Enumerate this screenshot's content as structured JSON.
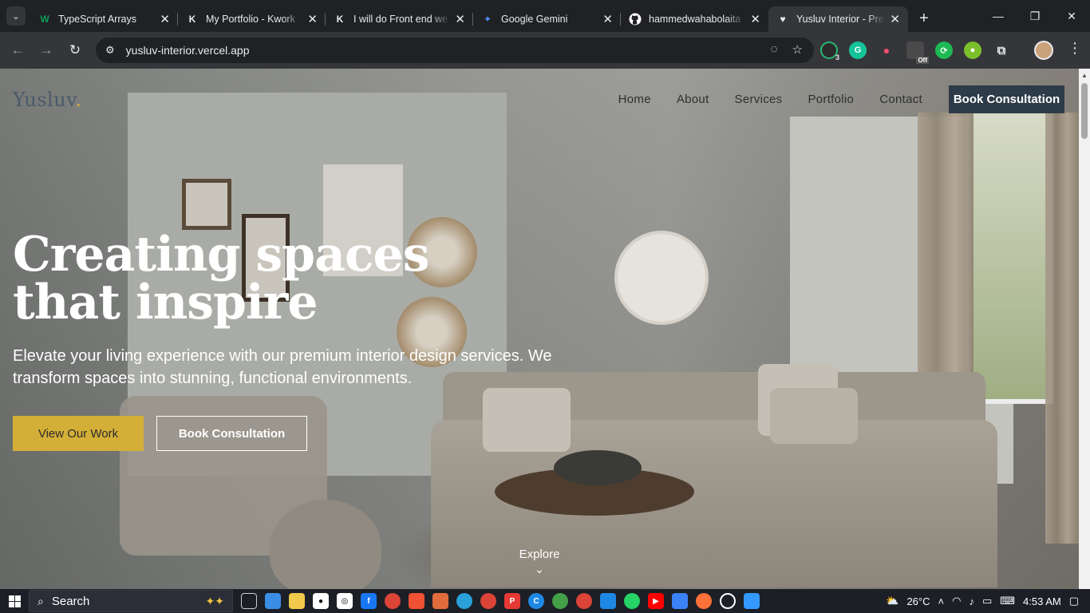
{
  "browser": {
    "tabs": [
      {
        "title": "TypeScript Arrays",
        "favicon": "W",
        "favicon_color": "#0f9d58",
        "active": false
      },
      {
        "title": "My Portfolio - Kwork",
        "favicon": "K",
        "favicon_color": "#ffffff",
        "active": false
      },
      {
        "title": "I will do Front end we",
        "favicon": "K",
        "favicon_color": "#ffffff",
        "active": false
      },
      {
        "title": "Google Gemini",
        "favicon": "✦",
        "favicon_color": "#4f8df7",
        "active": false
      },
      {
        "title": "hammedwahabolaita",
        "favicon": "github-icon",
        "favicon_color": "#ffffff",
        "active": false
      },
      {
        "title": "Yusluv Interior - Prem",
        "favicon": "♥",
        "favicon_color": "#ffffff",
        "active": true
      }
    ],
    "url": "yusluv-interior.vercel.app",
    "extension_badges": [
      "3",
      "Off"
    ]
  },
  "site": {
    "logo": "Yusluv",
    "logo_dot": ".",
    "nav": [
      "Home",
      "About",
      "Services",
      "Portfolio",
      "Contact"
    ],
    "nav_cta": "Book Consultation",
    "hero_title": "Creating spaces that inspire",
    "hero_subtitle": "Elevate your living experience with our premium interior design services. We transform spaces into stunning, functional environments.",
    "primary_button": "View Our Work",
    "secondary_button": "Book Consultation",
    "explore": "Explore",
    "colors": {
      "accent": "#d4af37",
      "dark": "#2e3b48",
      "logo": "#4b5b6b"
    }
  },
  "taskbar": {
    "search_placeholder": "Search",
    "weather": "26°C",
    "time": "4:53 AM"
  }
}
